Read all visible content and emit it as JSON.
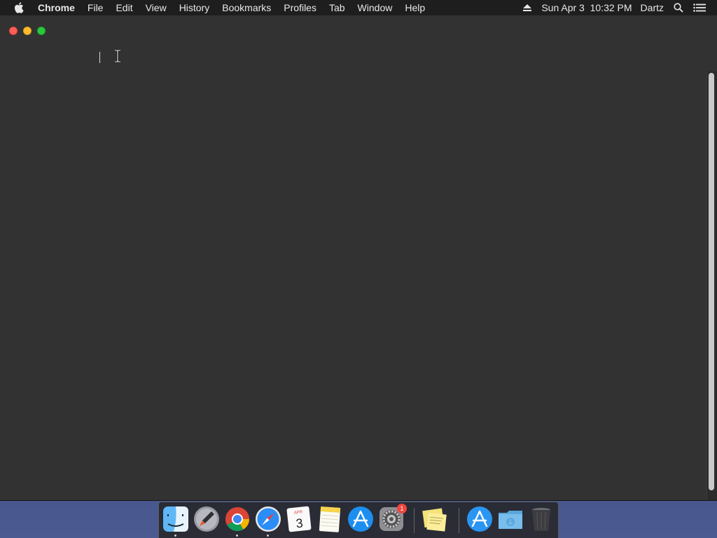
{
  "menubar": {
    "app_name": "Chrome",
    "items": [
      "File",
      "Edit",
      "View",
      "History",
      "Bookmarks",
      "Profiles",
      "Tab",
      "Window",
      "Help"
    ],
    "clock": "Sun Apr 3  10:32 PM",
    "user": "Dartz",
    "icons": [
      "apple-icon",
      "eject-icon",
      "spotlight-search-icon",
      "notification-center-icon"
    ]
  },
  "window": {
    "background": "#323232",
    "buttons": [
      "close",
      "minimize",
      "zoom"
    ]
  },
  "dock": {
    "apps": [
      {
        "name": "Finder",
        "icon": "finder-icon",
        "running": true
      },
      {
        "name": "Launchpad",
        "icon": "launchpad-icon",
        "running": false
      },
      {
        "name": "Google Chrome",
        "icon": "chrome-icon",
        "running": true
      },
      {
        "name": "Safari",
        "icon": "safari-icon",
        "running": true
      },
      {
        "name": "Calendar",
        "icon": "calendar-icon",
        "running": false,
        "month": "APR",
        "day": "3"
      },
      {
        "name": "Notes",
        "icon": "notes-icon",
        "running": false
      },
      {
        "name": "App Store",
        "icon": "app-store-icon",
        "running": false
      },
      {
        "name": "System Preferences",
        "icon": "system-preferences-icon",
        "running": false,
        "badge": "1"
      },
      {
        "name": "Stickies",
        "icon": "stickies-icon",
        "running": false
      },
      {
        "name": "App Store",
        "icon": "app-store-folder-icon",
        "running": false
      },
      {
        "name": "Downloads",
        "icon": "downloads-folder-icon",
        "running": false
      },
      {
        "name": "Trash",
        "icon": "trash-icon",
        "running": false
      }
    ]
  }
}
